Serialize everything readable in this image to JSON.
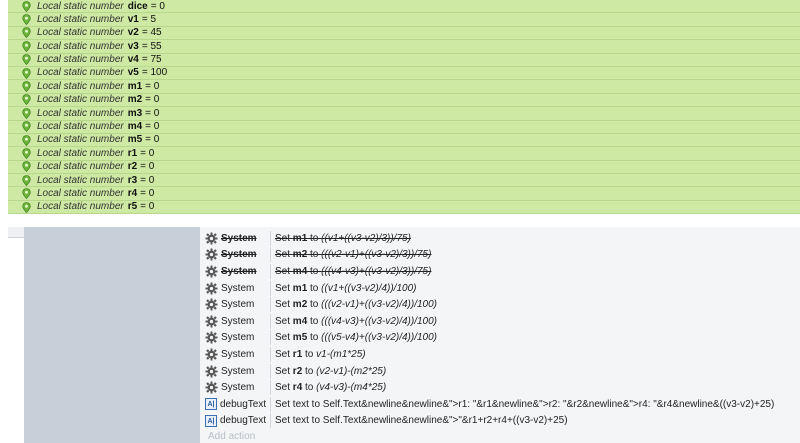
{
  "variables": {
    "label": "Local static number",
    "items": [
      {
        "name": "dice",
        "value": "= 0"
      },
      {
        "name": "v1",
        "value": "= 5"
      },
      {
        "name": "v2",
        "value": "= 45"
      },
      {
        "name": "v3",
        "value": "= 55"
      },
      {
        "name": "v4",
        "value": "= 75"
      },
      {
        "name": "v5",
        "value": "= 100"
      },
      {
        "name": "m1",
        "value": "= 0"
      },
      {
        "name": "m2",
        "value": "= 0"
      },
      {
        "name": "m3",
        "value": "= 0"
      },
      {
        "name": "m4",
        "value": "= 0"
      },
      {
        "name": "m5",
        "value": "= 0"
      },
      {
        "name": "r1",
        "value": "= 0"
      },
      {
        "name": "r2",
        "value": "= 0"
      },
      {
        "name": "r3",
        "value": "= 0"
      },
      {
        "name": "r4",
        "value": "= 0"
      },
      {
        "name": "r5",
        "value": "= 0"
      }
    ]
  },
  "actions": [
    {
      "object": "System",
      "icon": "gear-icon",
      "disabled": true,
      "prefix": "Set ",
      "var": "m1",
      "mid": " to ",
      "expr": "((v1+((v3-v2)/3))/75)"
    },
    {
      "object": "System",
      "icon": "gear-icon",
      "disabled": true,
      "prefix": "Set ",
      "var": "m2",
      "mid": " to ",
      "expr": "(((v2-v1)+((v3-v2)/3))/75)"
    },
    {
      "object": "System",
      "icon": "gear-icon",
      "disabled": true,
      "prefix": "Set ",
      "var": "m4",
      "mid": " to ",
      "expr": "(((v4-v3)+((v3-v2)/3))/75)"
    },
    {
      "object": "System",
      "icon": "gear-icon",
      "disabled": false,
      "prefix": "Set ",
      "var": "m1",
      "mid": " to ",
      "expr": "((v1+((v3-v2)/4))/100)"
    },
    {
      "object": "System",
      "icon": "gear-icon",
      "disabled": false,
      "prefix": "Set ",
      "var": "m2",
      "mid": " to ",
      "expr": "(((v2-v1)+((v3-v2)/4))/100)"
    },
    {
      "object": "System",
      "icon": "gear-icon",
      "disabled": false,
      "prefix": "Set ",
      "var": "m4",
      "mid": " to ",
      "expr": "(((v4-v3)+((v3-v2)/4))/100)"
    },
    {
      "object": "System",
      "icon": "gear-icon",
      "disabled": false,
      "prefix": "Set ",
      "var": "m5",
      "mid": " to ",
      "expr": "(((v5-v4)+((v3-v2)/4))/100)"
    },
    {
      "object": "System",
      "icon": "gear-icon",
      "disabled": false,
      "prefix": "Set ",
      "var": "r1",
      "mid": " to ",
      "expr": "v1-(m1*25)"
    },
    {
      "object": "System",
      "icon": "gear-icon",
      "disabled": false,
      "prefix": "Set ",
      "var": "r2",
      "mid": " to ",
      "expr": "(v2-v1)-(m2*25)"
    },
    {
      "object": "System",
      "icon": "gear-icon",
      "disabled": false,
      "prefix": "Set ",
      "var": "r4",
      "mid": " to ",
      "expr": "(v4-v3)-(m4*25)"
    },
    {
      "object": "debugText",
      "icon": "text-object-icon",
      "disabled": false,
      "prefix": "Set text to Self.Text&newline&newline&\">r1: \"&r1&newline&\">r2: \"&r2&newline&\">r4: \"&r4&newline&((v3-v2)+25)",
      "var": "",
      "mid": "",
      "expr": ""
    },
    {
      "object": "debugText",
      "icon": "text-object-icon",
      "disabled": false,
      "prefix": "Set text to Self.Text&newline&newline&\">\"&r1+r2+r4+((v3-v2)+25)",
      "var": "",
      "mid": "",
      "expr": ""
    }
  ],
  "add_action_label": "Add action",
  "colors": {
    "variable_row": "#cde9a3",
    "actions_bg": "#f4f5f7",
    "condition_block": "#c8cfd9"
  }
}
